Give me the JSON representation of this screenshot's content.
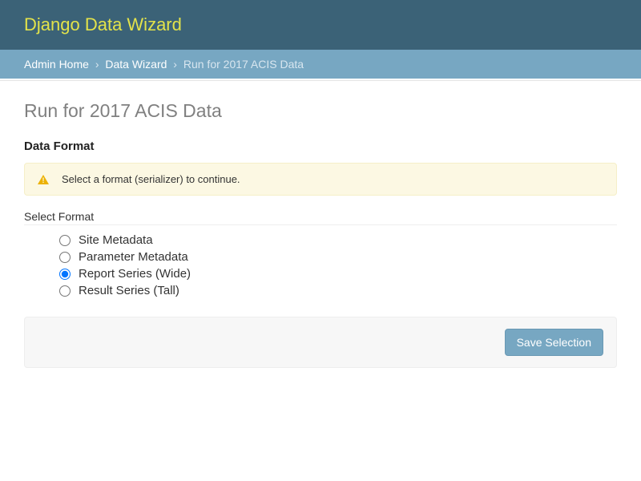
{
  "brand": "Django Data Wizard",
  "breadcrumb": {
    "items": [
      {
        "label": "Admin Home",
        "link": true
      },
      {
        "label": "Data Wizard",
        "link": true
      },
      {
        "label": "Run for 2017 ACIS Data",
        "link": false
      }
    ],
    "separator": "›"
  },
  "page_title": "Run for 2017 ACIS Data",
  "section_title": "Data Format",
  "alert": {
    "icon": "warning-triangle",
    "text": "Select a format (serializer) to continue."
  },
  "format_field": {
    "label": "Select Format",
    "options": [
      {
        "label": "Site Metadata",
        "selected": false
      },
      {
        "label": "Parameter Metadata",
        "selected": false
      },
      {
        "label": "Report Series (Wide)",
        "selected": true
      },
      {
        "label": "Result Series (Tall)",
        "selected": false
      }
    ]
  },
  "buttons": {
    "save": "Save Selection"
  }
}
